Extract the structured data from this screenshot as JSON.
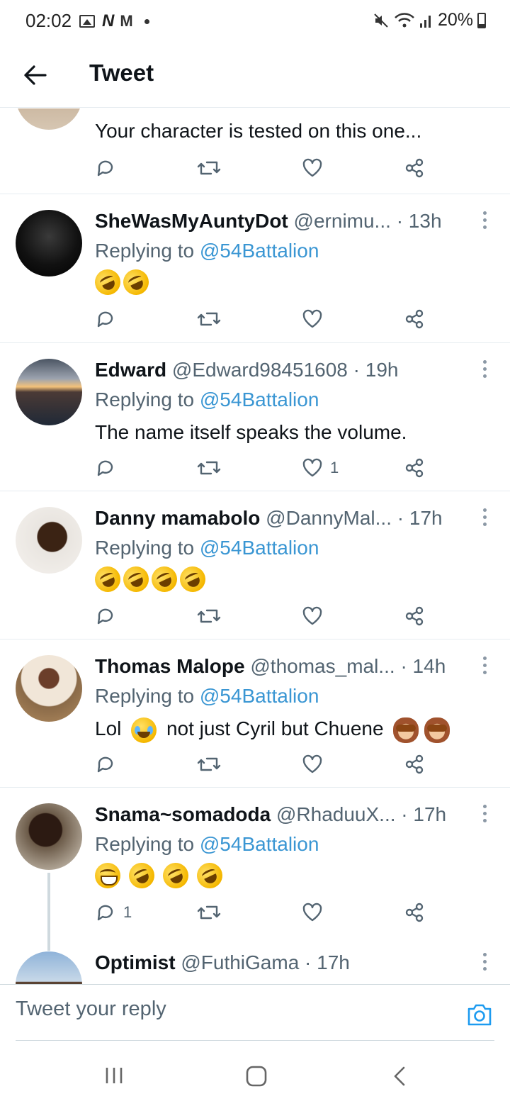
{
  "status_bar": {
    "time": "02:02",
    "battery": "20%"
  },
  "header": {
    "title": "Tweet"
  },
  "colors": {
    "link": "#3a96d3",
    "muted": "#536471",
    "divider": "#e6ecf0"
  },
  "partial_tweet": {
    "text": "Your character is tested on this one..."
  },
  "tweets": [
    {
      "name": "SheWasMyAuntyDot",
      "handle": "@ernimu...",
      "time": "13h",
      "replying_label": "Replying to",
      "replying_to": "@54Battalion",
      "emojis": [
        "rofl",
        "rofl"
      ],
      "likes": "",
      "replies": ""
    },
    {
      "name": "Edward",
      "handle": "@Edward98451608",
      "time": "19h",
      "replying_label": "Replying to",
      "replying_to": "@54Battalion",
      "text": "The name itself speaks the volume.",
      "likes": "1",
      "replies": ""
    },
    {
      "name": "Danny mamabolo",
      "handle": "@DannyMal...",
      "time": "17h",
      "replying_label": "Replying to",
      "replying_to": "@54Battalion",
      "emojis": [
        "rofl",
        "rofl",
        "rofl",
        "rofl"
      ],
      "likes": "",
      "replies": ""
    },
    {
      "name": "Thomas Malope",
      "handle": "@thomas_mal...",
      "time": "14h",
      "replying_label": "Replying to",
      "replying_to": "@54Battalion",
      "text_before": "Lol",
      "text_after": "not just Cyril but Chuene",
      "likes": "",
      "replies": ""
    },
    {
      "name": "Snama~somadoda",
      "handle": "@RhaduuX...",
      "time": "17h",
      "replying_label": "Replying to",
      "replying_to": "@54Battalion",
      "emojis": [
        "grin",
        "rofl",
        "rofl",
        "rofl"
      ],
      "likes": "",
      "replies": "1"
    },
    {
      "name": "Optimist",
      "handle": "@FuthiGama",
      "time": "17h"
    }
  ],
  "separator": "·",
  "reply_bar": {
    "placeholder": "Tweet your reply"
  }
}
